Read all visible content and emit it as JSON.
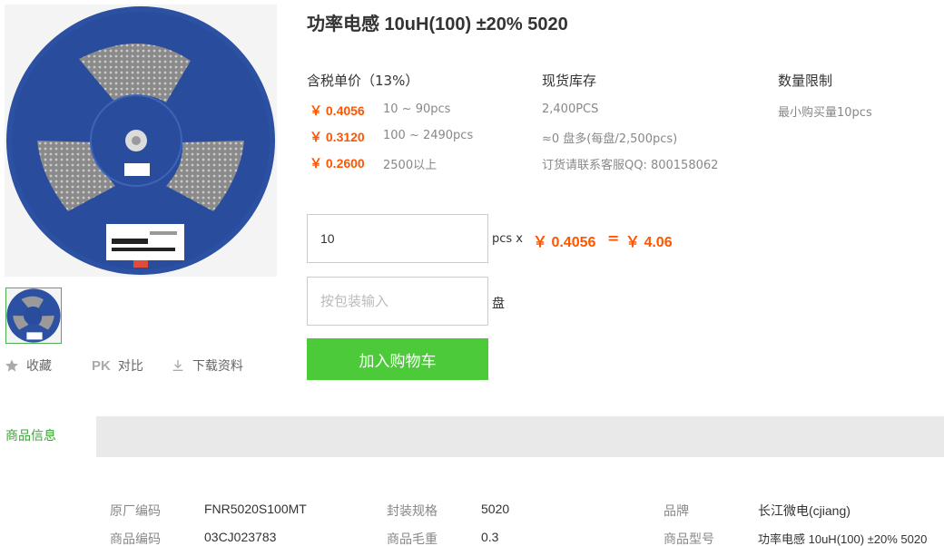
{
  "product": {
    "title": "功率电感 10uH(100) ±20% 5020"
  },
  "gallery": {
    "main_alt": "inductor reel",
    "thumb_alt": "inductor reel thumbnail"
  },
  "actions": {
    "favorite_icon": "star-icon",
    "favorite_label": "收藏",
    "compare_prefix": "PK",
    "compare_label": "对比",
    "download_icon": "download-icon",
    "download_label": "下载资料"
  },
  "pricing": {
    "header": "含税单价（13%）",
    "tiers": [
      {
        "price": "￥ 0.4056",
        "range": "10 ~ 90pcs"
      },
      {
        "price": "￥ 0.3120",
        "range": "100 ~ 2490pcs"
      },
      {
        "price": "￥ 0.2600",
        "range": "2500以上"
      }
    ]
  },
  "stock": {
    "header": "现货库存",
    "lines": [
      "2,400PCS",
      "≈0 盘多(每盘/2,500pcs)",
      "订货请联系客服QQ: 800158062"
    ]
  },
  "limit": {
    "header": "数量限制",
    "min_purchase": "最小购买量10pcs"
  },
  "order": {
    "quantity_value": "10",
    "pcs_x": "pcs x",
    "unit_price": "￥ 0.4056",
    "equals": "=",
    "total": "￥ 4.06",
    "reel_placeholder": "按包装输入",
    "reel_unit": "盘",
    "add_to_cart": "加入购物车"
  },
  "tabs": {
    "active": "商品信息"
  },
  "specs": [
    [
      {
        "label": "原厂编码",
        "value": "FNR5020S100MT"
      },
      {
        "label": "封装规格",
        "value": "5020"
      },
      {
        "label": "品牌",
        "value": "长江微电(cjiang)"
      }
    ],
    [
      {
        "label": "商品编码",
        "value": "03CJ023783"
      },
      {
        "label": "商品毛重",
        "value": "0.3"
      },
      {
        "label": "商品型号",
        "value": "功率电感 10uH(100) ±20% 5020"
      }
    ]
  ],
  "colors": {
    "accent_orange": "#ff5500",
    "cart_green": "#4cca3a",
    "reel_blue": "#2a4fa0"
  }
}
